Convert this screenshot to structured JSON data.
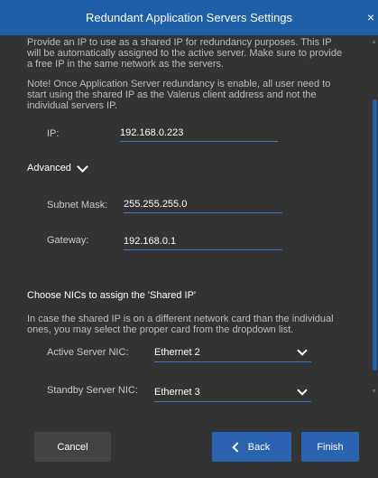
{
  "window": {
    "title": "Redundant Application Servers Settings",
    "close_glyph": "×"
  },
  "intro": {
    "text": "Provide an IP to use as a shared IP for redundancy purposes. This IP will be automatically assigned to the active server. Make sure to provide a free IP in the same network as the servers.",
    "note": "Note! Once Application Server redundancy is enable, all user need to start using the shared IP as the Valerus client address and not the individual servers IP."
  },
  "ip": {
    "label": "IP:",
    "value": "192.168.0.223"
  },
  "advanced": {
    "label": "Advanced",
    "subnet_label": "Subnet Mask:",
    "subnet_value": "255.255.255.0",
    "gateway_label": "Gateway:",
    "gateway_value": "192.168.0.1"
  },
  "nics": {
    "title": "Choose NICs to assign the 'Shared IP'",
    "description": "In case the shared IP is on a different network card than the individual ones, you may select the proper card from the dropdown list.",
    "active_label": "Active Server NIC:",
    "active_value": "Ethernet 2",
    "standby_label": "Standby Server NIC:",
    "standby_value": "Ethernet 3"
  },
  "buttons": {
    "cancel": "Cancel",
    "back": "Back",
    "finish": "Finish"
  },
  "colors": {
    "titlebar": "#1f5fa8",
    "accent": "#2a64b0",
    "background": "#333333"
  }
}
